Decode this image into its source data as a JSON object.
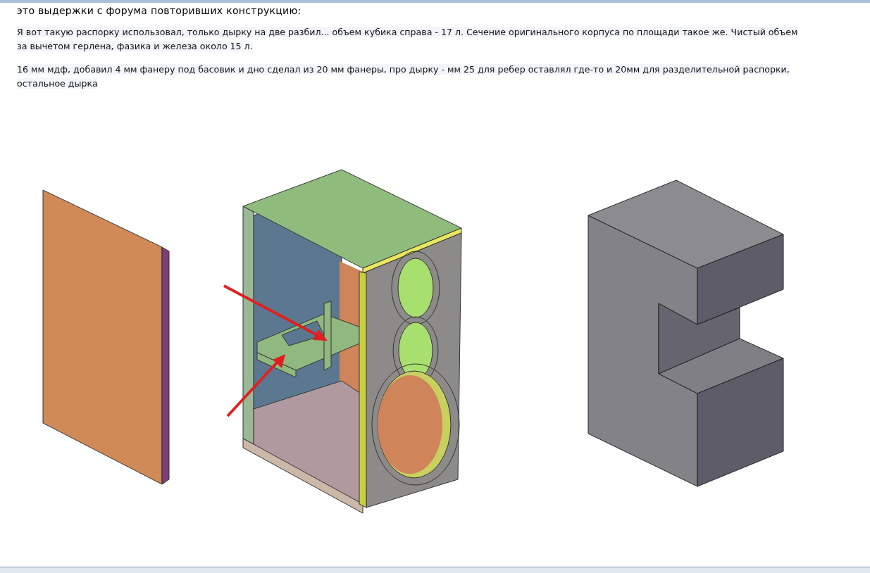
{
  "document": {
    "heading": "это выдержки с форума повторивших конструкцию:",
    "paragraphs": [
      {
        "lines": [
          "Я вот такую распорку использовал, только дырку на две разбил... объем кубика справа - 17 л. Сечение оригинального корпуса по площади такое же. Чистый объем",
          "за вычетом герлена, фазика и железа около 15 л."
        ]
      },
      {
        "lines": [
          "16 мм мдф, добавил 4 мм фанеру под басовик и дно сделал из 20 мм фанеры, про дырку - мм 25 для ребер оставлял где-то и 20мм для разделительной распорки,",
          "остальное дырка"
        ]
      }
    ]
  }
}
